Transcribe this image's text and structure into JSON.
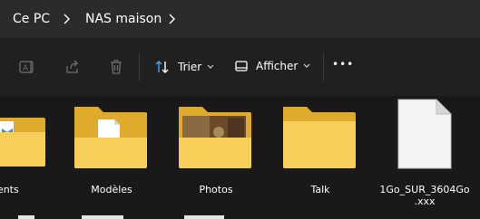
{
  "breadcrumb": {
    "items": [
      {
        "label": "Ce PC"
      },
      {
        "label": "NAS maison"
      }
    ]
  },
  "toolbar": {
    "sort_label": "Trier",
    "view_label": "Afficher",
    "more_label": "•••"
  },
  "files": [
    {
      "name": "uments",
      "type": "folder-doc"
    },
    {
      "name": "Modèles",
      "type": "folder-template"
    },
    {
      "name": "Photos",
      "type": "folder-photo"
    },
    {
      "name": "Talk",
      "type": "folder"
    },
    {
      "name": "1Go_SUR_3604Go",
      "name_line2": ".xxx",
      "type": "file"
    }
  ],
  "colors": {
    "breadcrumb_bg": "#2b2b2b",
    "toolbar_bg": "#202020",
    "content_bg": "#191919",
    "folder": "#f4c542",
    "folder_front": "#f9d86a",
    "sort_icon": "#4ea1e6"
  }
}
